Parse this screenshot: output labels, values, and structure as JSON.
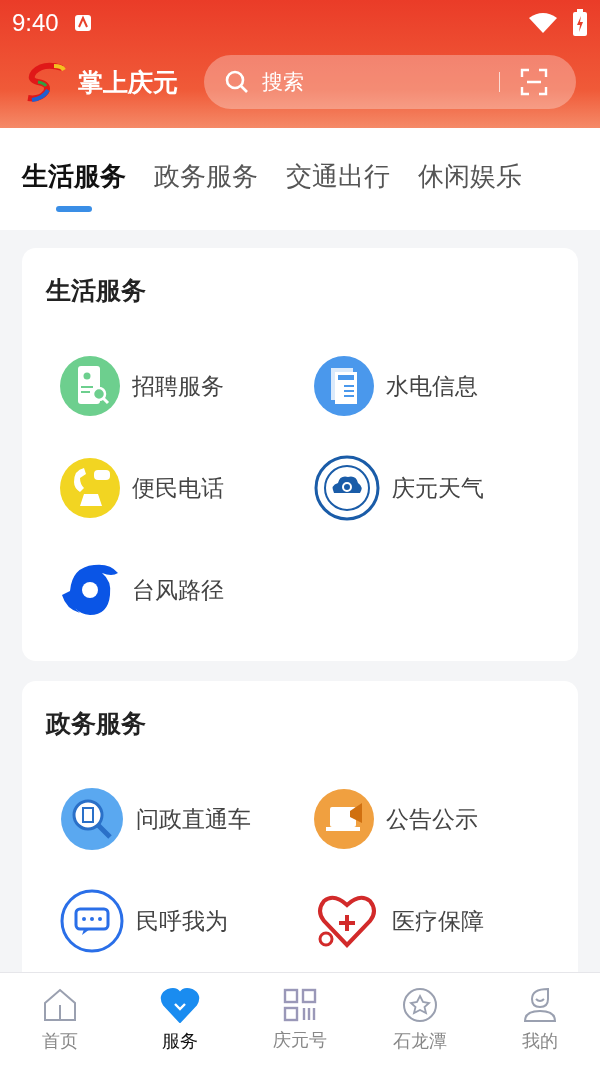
{
  "status_bar": {
    "time": "9:40"
  },
  "header": {
    "app_name": "掌上庆元",
    "search": {
      "placeholder": "搜索"
    }
  },
  "tabs": [
    {
      "label": "生活服务",
      "selected": true
    },
    {
      "label": "政务服务",
      "selected": false
    },
    {
      "label": "交通出行",
      "selected": false
    },
    {
      "label": "休闲娱乐",
      "selected": false
    }
  ],
  "sections": [
    {
      "title": "生活服务",
      "items": [
        {
          "label": "招聘服务",
          "kind": "recruit"
        },
        {
          "label": "水电信息",
          "kind": "utility"
        },
        {
          "label": "便民电话",
          "kind": "phone"
        },
        {
          "label": "庆元天气",
          "kind": "weather"
        },
        {
          "label": "台风路径",
          "kind": "typhoon"
        }
      ]
    },
    {
      "title": "政务服务",
      "items": [
        {
          "label": "问政直通车",
          "kind": "inquiry"
        },
        {
          "label": "公告公示",
          "kind": "notice"
        },
        {
          "label": "民呼我为",
          "kind": "chat"
        },
        {
          "label": "医疗保障",
          "kind": "medical"
        }
      ]
    }
  ],
  "bottom_nav": [
    {
      "label": "首页",
      "kind": "home",
      "selected": false
    },
    {
      "label": "服务",
      "kind": "service",
      "selected": true
    },
    {
      "label": "庆元号",
      "kind": "grid",
      "selected": false
    },
    {
      "label": "石龙潭",
      "kind": "star",
      "selected": false
    },
    {
      "label": "我的",
      "kind": "user",
      "selected": false
    }
  ]
}
